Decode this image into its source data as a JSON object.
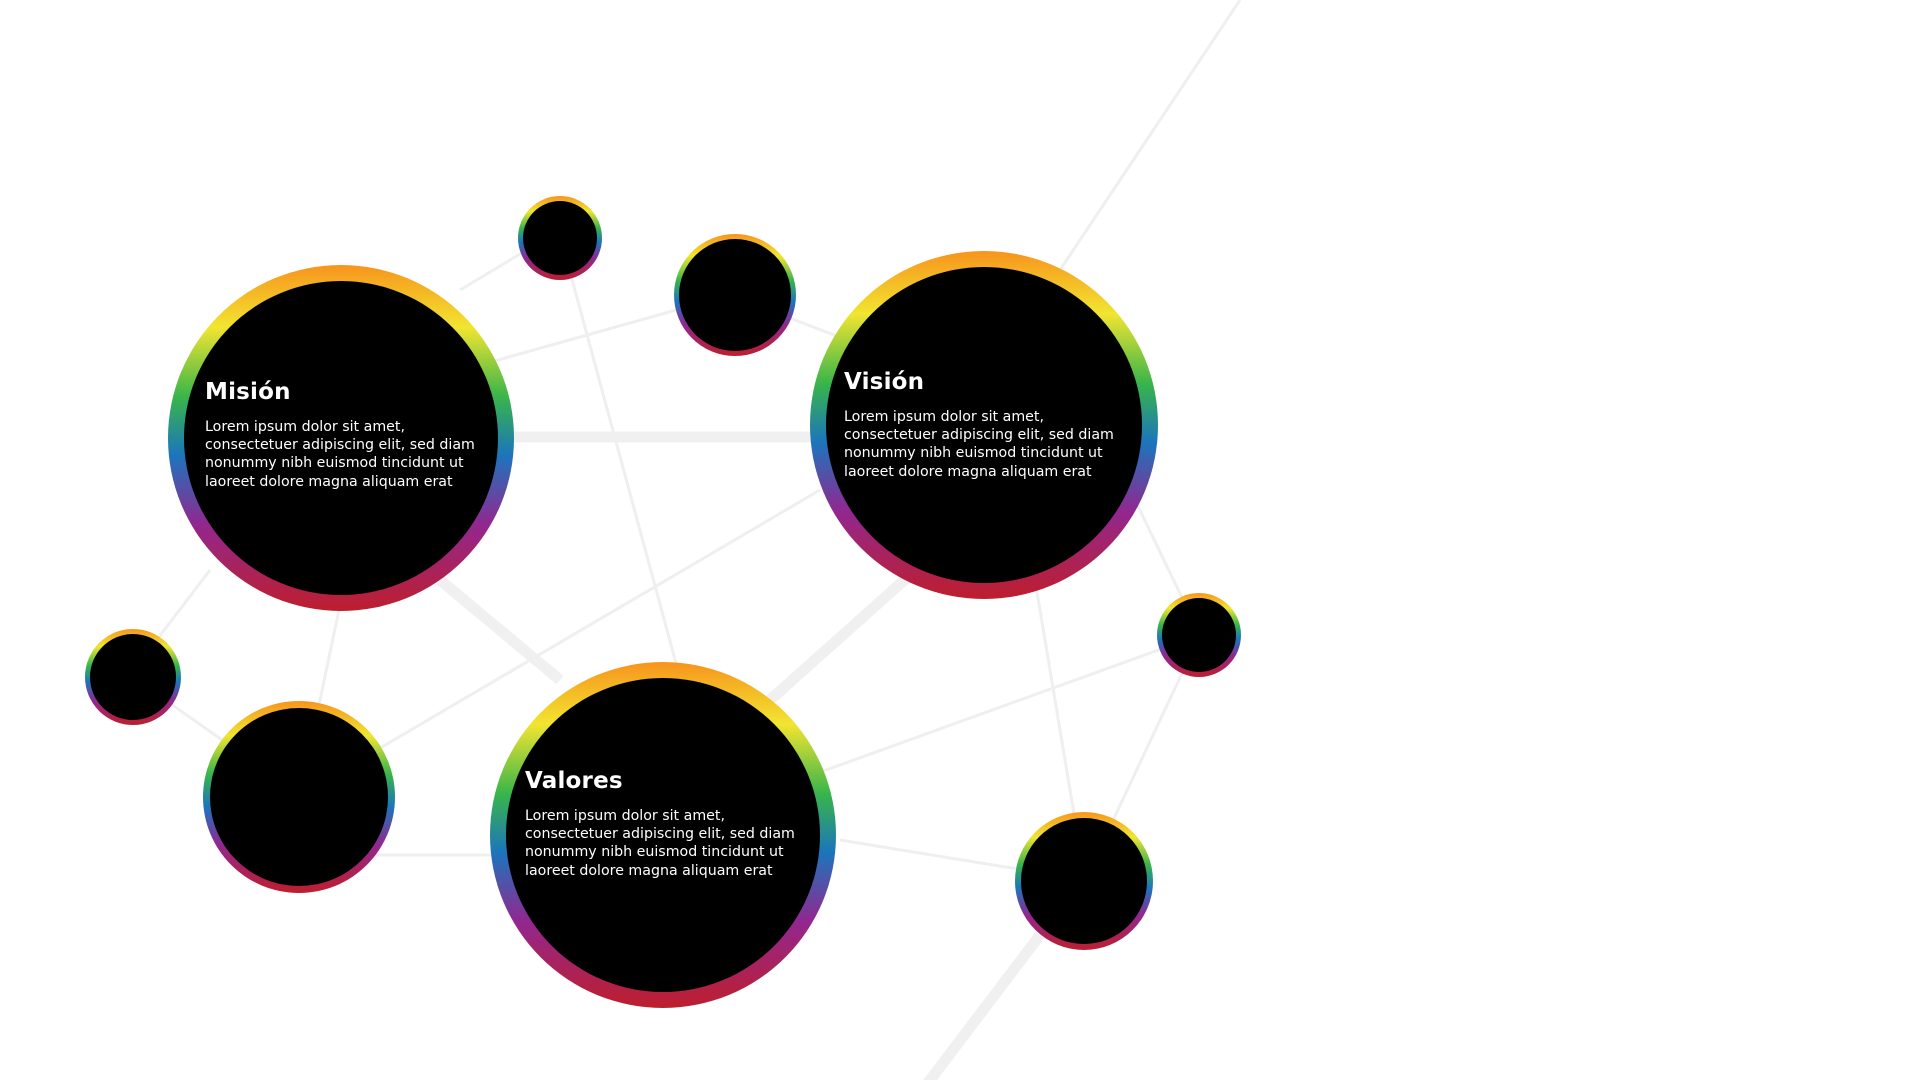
{
  "nodes": {
    "mision": {
      "title": "Misión",
      "body": "Lorem ipsum dolor sit amet, consectetuer adipiscing elit, sed diam nonummy nibh euismod tincidunt ut laoreet dolore magna aliquam erat"
    },
    "vision": {
      "title": "Visión",
      "body": "Lorem ipsum dolor sit amet, consectetuer adipiscing elit, sed diam nonummy nibh euismod tincidunt ut laoreet dolore magna aliquam erat"
    },
    "valores": {
      "title": "Valores",
      "body": "Lorem ipsum dolor sit amet, consectetuer adipiscing elit, sed diam nonummy nibh euismod tincidunt ut laoreet dolore magna aliquam erat"
    }
  },
  "colors": {
    "background": "#ffffff",
    "node_fill": "#000000",
    "connector": "#efefef",
    "ring_gradient": [
      "#f7941d",
      "#f2e530",
      "#39b54a",
      "#1c75bc",
      "#92278f",
      "#be1e2d"
    ]
  }
}
